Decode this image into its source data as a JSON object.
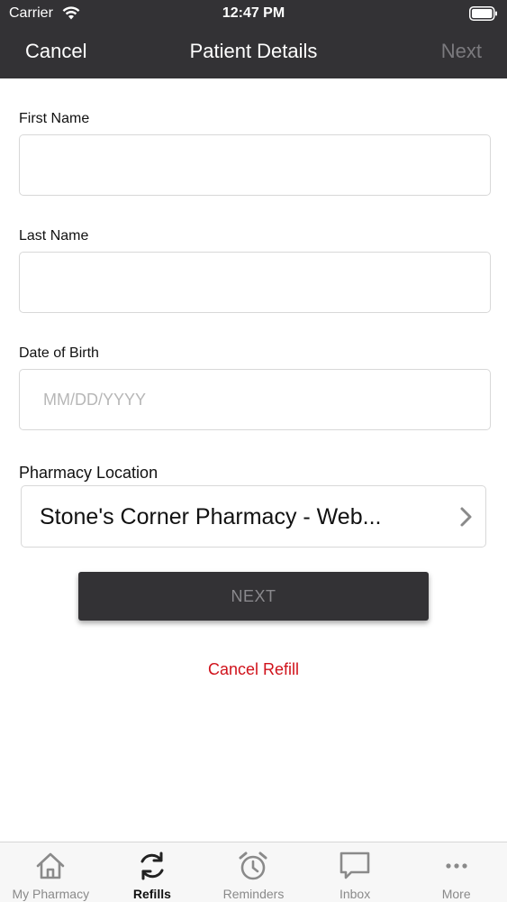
{
  "status_bar": {
    "carrier": "Carrier",
    "time": "12:47 PM"
  },
  "nav": {
    "cancel_label": "Cancel",
    "title": "Patient Details",
    "next_label": "Next"
  },
  "form": {
    "first_name": {
      "label": "First Name",
      "value": "",
      "placeholder": ""
    },
    "last_name": {
      "label": "Last Name",
      "value": "",
      "placeholder": ""
    },
    "dob": {
      "label": "Date of Birth",
      "value": "",
      "placeholder": "MM/DD/YYYY"
    },
    "pharmacy": {
      "label": "Pharmacy Location",
      "value": "Stone's Corner Pharmacy -  Web..."
    }
  },
  "next_button_label": "NEXT",
  "cancel_refill_label": "Cancel Refill",
  "tabs": [
    {
      "label": "My Pharmacy",
      "icon": "home-icon",
      "active": false
    },
    {
      "label": "Refills",
      "icon": "refresh-icon",
      "active": true
    },
    {
      "label": "Reminders",
      "icon": "alarm-clock-icon",
      "active": false
    },
    {
      "label": "Inbox",
      "icon": "chat-bubble-icon",
      "active": false
    },
    {
      "label": "More",
      "icon": "more-dots-icon",
      "active": false
    }
  ],
  "colors": {
    "header": "#333235",
    "accent_red": "#d0121b",
    "disabled_text": "#7b7a7e"
  }
}
